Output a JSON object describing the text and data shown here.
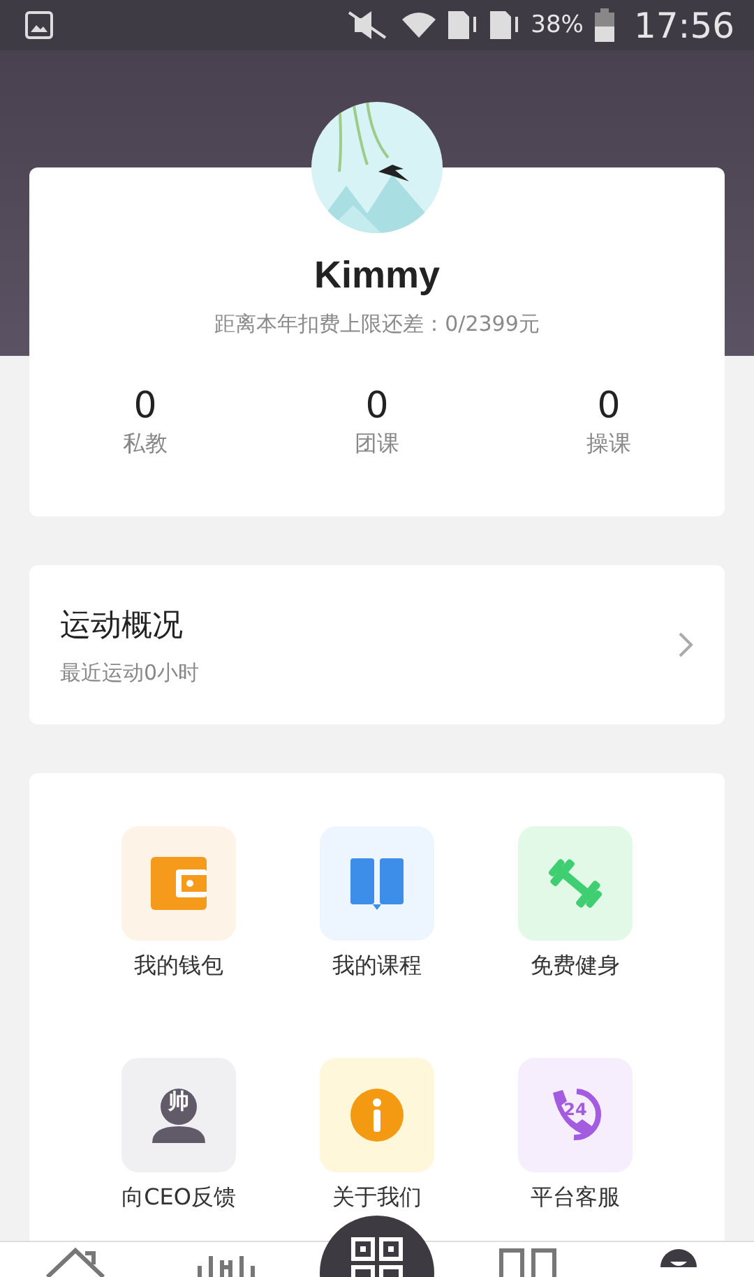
{
  "status_bar": {
    "battery": "38%",
    "time": "17:56"
  },
  "profile": {
    "name": "Kimmy",
    "subtitle": "距离本年扣费上限还差：0/2399元",
    "stats": [
      {
        "value": "0",
        "label": "私教"
      },
      {
        "value": "0",
        "label": "团课"
      },
      {
        "value": "0",
        "label": "操课"
      }
    ]
  },
  "overview": {
    "title": "运动概况",
    "subtitle": "最近运动0小时"
  },
  "menu": [
    {
      "kind": "wallet",
      "label": "我的钱包",
      "color": "#f59a1b"
    },
    {
      "kind": "book",
      "label": "我的课程",
      "color": "#3d8ee8"
    },
    {
      "kind": "dumbbell",
      "label": "免费健身",
      "color": "#3fce72"
    },
    {
      "kind": "person",
      "label": "向CEO反馈",
      "color": "#615a68",
      "badge": "帅"
    },
    {
      "kind": "info",
      "label": "关于我们",
      "color": "#f39a12"
    },
    {
      "kind": "phone",
      "label": "平台客服",
      "color": "#a35be0",
      "badge": "24"
    }
  ],
  "bottom_nav": [
    {
      "kind": "home"
    },
    {
      "kind": "gym"
    },
    {
      "kind": "scan"
    },
    {
      "kind": "book"
    },
    {
      "kind": "profile"
    }
  ]
}
